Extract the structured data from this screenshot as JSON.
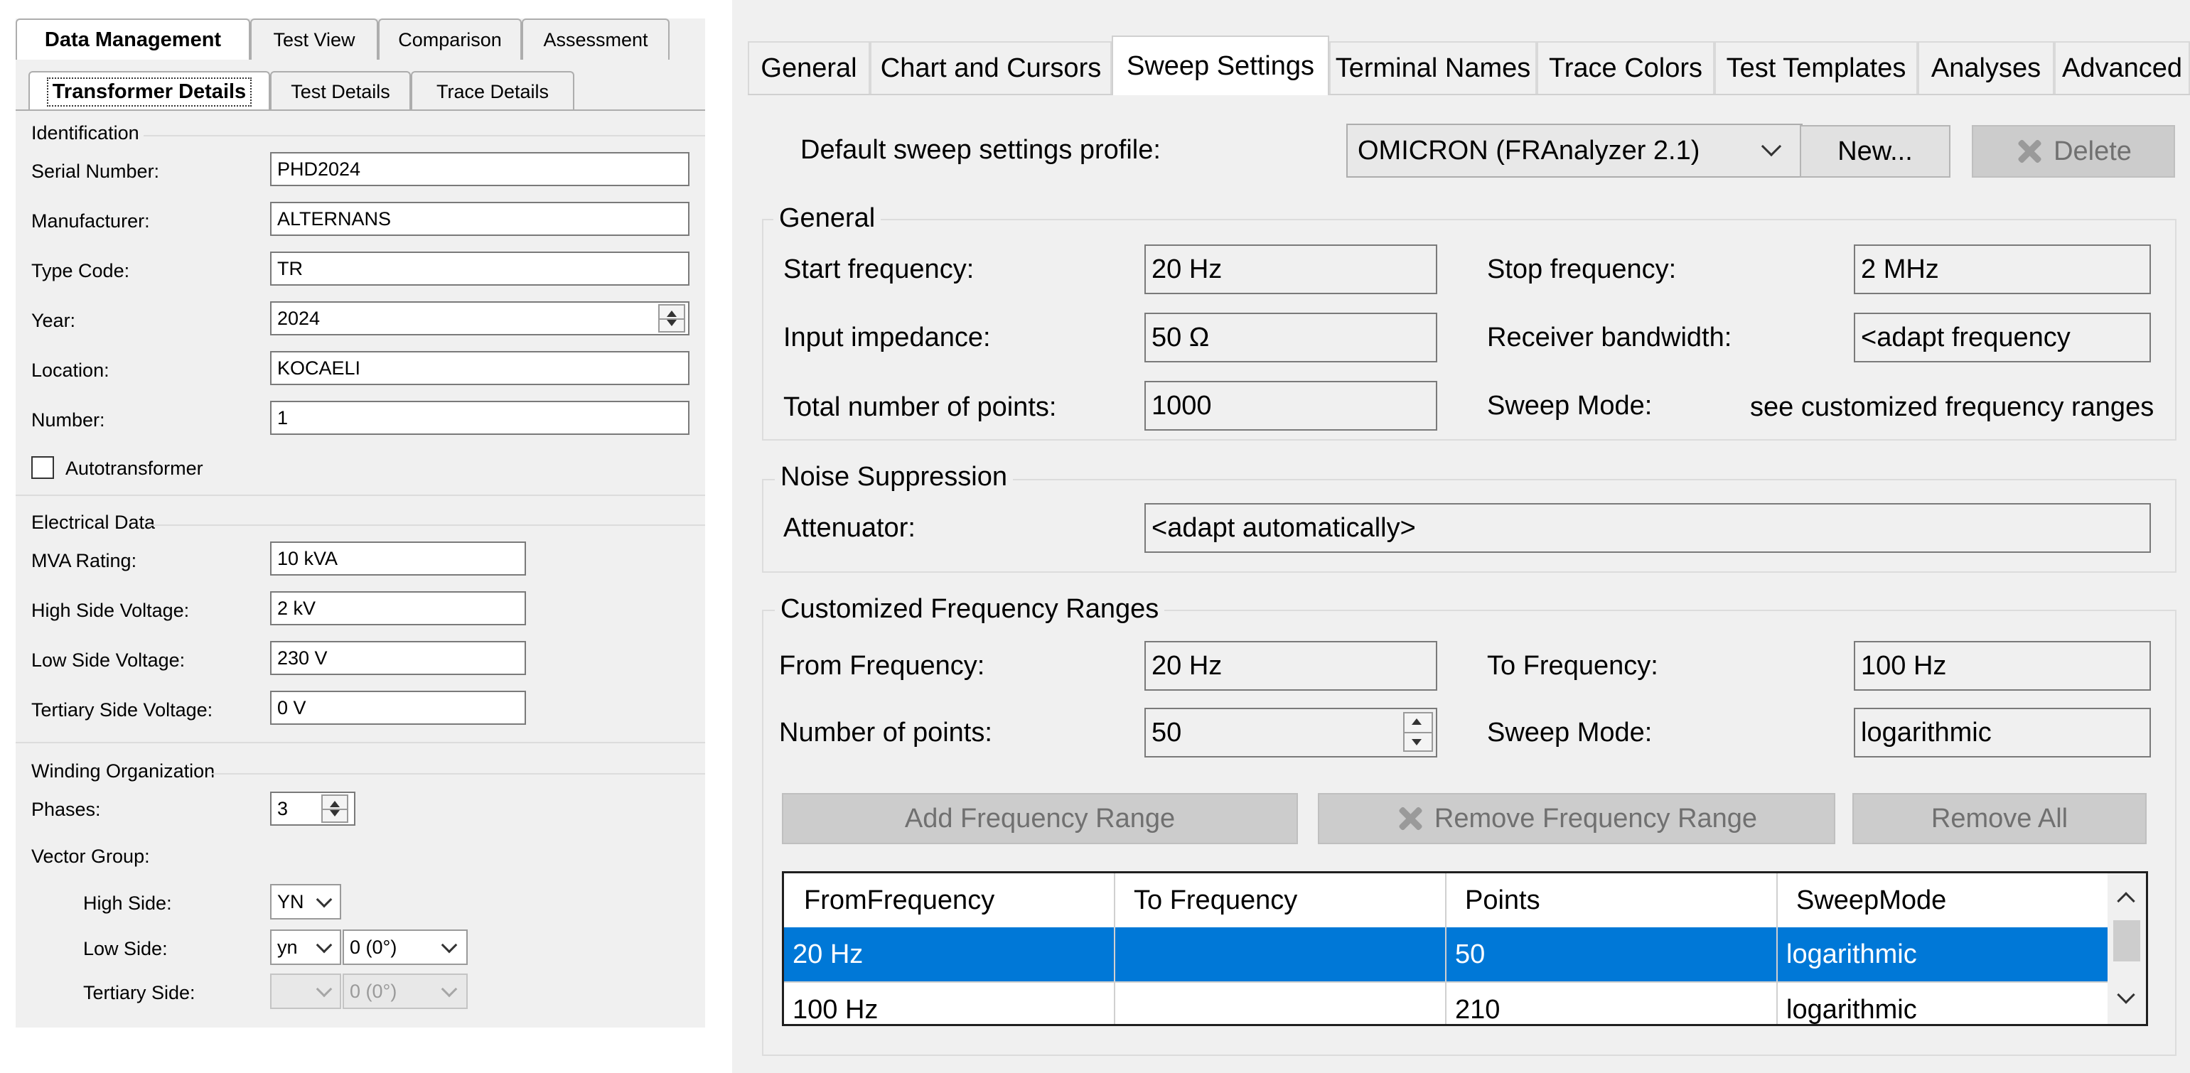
{
  "left": {
    "tabs": [
      "Data Management",
      "Test View",
      "Comparison",
      "Assessment"
    ],
    "subtabs": [
      "Transformer Details",
      "Test Details",
      "Trace Details"
    ],
    "identification": {
      "title": "Identification",
      "serial_label": "Serial Number:",
      "serial_value": "PHD2024",
      "manufacturer_label": "Manufacturer:",
      "manufacturer_value": "ALTERNANS",
      "type_label": "Type Code:",
      "type_value": "TR",
      "year_label": "Year:",
      "year_value": "2024",
      "location_label": "Location:",
      "location_value": "KOCAELI",
      "number_label": "Number:",
      "number_value": "1",
      "auto_label": "Autotransformer"
    },
    "electrical": {
      "title": "Electrical Data",
      "mva_label": "MVA Rating:",
      "mva_value": "10 kVA",
      "hv_label": "High Side Voltage:",
      "hv_value": "2 kV",
      "lv_label": "Low Side Voltage:",
      "lv_value": "230 V",
      "tv_label": "Tertiary Side Voltage:",
      "tv_value": "0 V"
    },
    "winding": {
      "title": "Winding Organization",
      "phases_label": "Phases:",
      "phases_value": "3",
      "vector_label": "Vector Group:",
      "high_label": "High Side:",
      "high_value": "YN",
      "low_label": "Low Side:",
      "low_value": "yn",
      "low_angle": "0 (0°)",
      "tertiary_label": "Tertiary Side:",
      "tertiary_value": "",
      "tertiary_angle": "0 (0°)"
    }
  },
  "right": {
    "tabs": [
      "General",
      "Chart and Cursors",
      "Sweep Settings",
      "Terminal Names",
      "Trace Colors",
      "Test Templates",
      "Analyses",
      "Advanced"
    ],
    "profile_label": "Default sweep settings profile:",
    "profile_value": "OMICRON (FRAnalyzer 2.1)",
    "new_button": "New...",
    "delete_button": "Delete",
    "general": {
      "title": "General",
      "start_label": "Start frequency:",
      "start_value": "20 Hz",
      "stop_label": "Stop frequency:",
      "stop_value": "2 MHz",
      "impedance_label": "Input impedance:",
      "impedance_value": "50 Ω",
      "bandwidth_label": "Receiver bandwidth:",
      "bandwidth_value": "<adapt frequency",
      "points_label": "Total number of points:",
      "points_value": "1000",
      "mode_label": "Sweep Mode:",
      "mode_value": "see customized frequency ranges"
    },
    "noise": {
      "title": "Noise Suppression",
      "attenuator_label": "Attenuator:",
      "attenuator_value": "<adapt automatically>"
    },
    "custom": {
      "title": "Customized Frequency Ranges",
      "from_label": "From Frequency:",
      "from_value": "20 Hz",
      "to_label": "To Frequency:",
      "to_value": "100 Hz",
      "npoints_label": "Number of points:",
      "npoints_value": "50",
      "mode_label": "Sweep Mode:",
      "mode_value": "logarithmic",
      "add_button": "Add Frequency Range",
      "remove_button": "Remove Frequency Range",
      "remove_all_button": "Remove All"
    },
    "grid": {
      "headers": [
        "FromFrequency",
        "To Frequency",
        "Points",
        "SweepMode"
      ],
      "rows": [
        [
          "20 Hz",
          "",
          "50",
          "logarithmic"
        ],
        [
          "100 Hz",
          "",
          "210",
          "logarithmic"
        ]
      ]
    }
  },
  "colors": {
    "selection": "#0078d7",
    "panel": "#f0f0f0",
    "disabled_button": "#cccccc"
  }
}
